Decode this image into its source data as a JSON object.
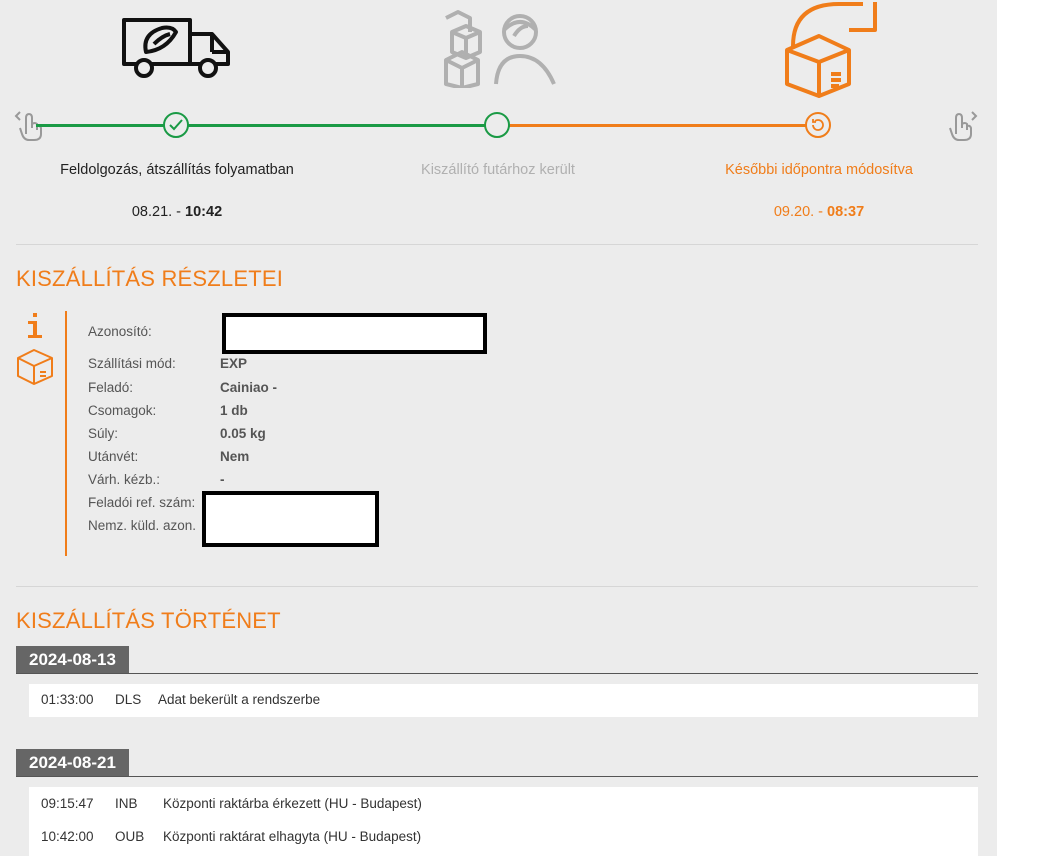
{
  "colors": {
    "accent": "#f07d1a",
    "success": "#1a9a45",
    "muted": "#b0b0b0",
    "panel": "#ececec"
  },
  "tracker": {
    "steps": [
      {
        "icon": "delivery-truck-icon",
        "state": "done",
        "label": "Feldolgozás, átszállítás folyamatban",
        "date": "08.21. - ",
        "time": "10:42"
      },
      {
        "icon": "courier-with-boxes-icon",
        "state": "inactive",
        "label": "Kiszállító futárhoz került",
        "date": "",
        "time": ""
      },
      {
        "icon": "rescheduled-package-icon",
        "state": "current",
        "label": "Későbbi időpontra módosítva",
        "date": "09.20. - ",
        "time": "08:37"
      }
    ]
  },
  "details": {
    "title": "KISZÁLLÍTÁS RÉSZLETEI",
    "rows": [
      {
        "label": "Azonosító:",
        "value": ""
      },
      {
        "label": "Szállítási mód:",
        "value": "EXP"
      },
      {
        "label": "Feladó:",
        "value": "Cainiao -"
      },
      {
        "label": "Csomagok:",
        "value": "1 db"
      },
      {
        "label": "Súly:",
        "value": "0.05 kg"
      },
      {
        "label": "Utánvét:",
        "value": "Nem"
      },
      {
        "label": "Várh. kézb.:",
        "value": "-"
      },
      {
        "label": "Feladói ref. szám:",
        "value": ""
      },
      {
        "label": "Nemz. küld. azon.",
        "value": ""
      }
    ]
  },
  "history": {
    "title": "KISZÁLLÍTÁS TÖRTÉNET",
    "days": [
      {
        "date": "2024-08-13",
        "events": [
          {
            "time": "01:33:00",
            "code": "DLS",
            "text": "Adat bekerült a rendszerbe"
          }
        ]
      },
      {
        "date": "2024-08-21",
        "events": [
          {
            "time": "09:15:47",
            "code": "INB",
            "text": "Központi raktárba érkezett (HU - Budapest)"
          },
          {
            "time": "10:42:00",
            "code": "OUB",
            "text": "Központi raktárat elhagyta (HU - Budapest)"
          }
        ]
      }
    ]
  }
}
